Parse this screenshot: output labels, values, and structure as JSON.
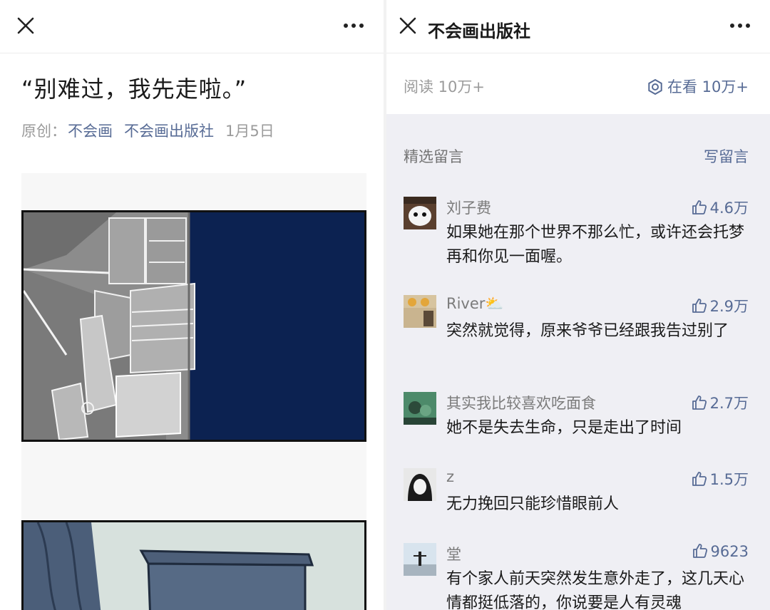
{
  "left": {
    "title": "“别难过，我先走啦。”",
    "meta": {
      "original_label": "原创：",
      "author": "不会画",
      "account": "不会画出版社",
      "date": "1月5日"
    }
  },
  "right": {
    "account_title": "不会画出版社",
    "reads": "阅读 10万+",
    "watching": "在看 10万+",
    "section_title": "精选留言",
    "write_comment": "写留言",
    "comments": [
      {
        "name": "刘子费",
        "likes": "4.6万",
        "text": "如果她在那个世界不那么忙，或许还会托梦再和你见一面喔。"
      },
      {
        "name": "River⛅",
        "likes": "2.9万",
        "text": "突然就觉得，原来爷爷已经跟我告过别了"
      },
      {
        "name": "其实我比较喜欢吃面食",
        "likes": "2.7万",
        "text": "她不是失去生命，只是走出了时间"
      },
      {
        "name": "z",
        "likes": "1.5万",
        "text": "无力挽回只能珍惜眼前人"
      },
      {
        "name": "堂",
        "likes": "9623",
        "text": "有个家人前天突然发生意外走了，这几天心情都挺低落的，你说要是人有灵魂"
      }
    ]
  },
  "icons": {
    "close": "close-icon",
    "more": "more-icon",
    "watching": "watching-icon",
    "like": "thumbs-up-icon"
  },
  "colors": {
    "link": "#576b95",
    "muted": "#9b9b9b",
    "comment_bg": "#efeff4",
    "night_sky": "#0c2251"
  }
}
